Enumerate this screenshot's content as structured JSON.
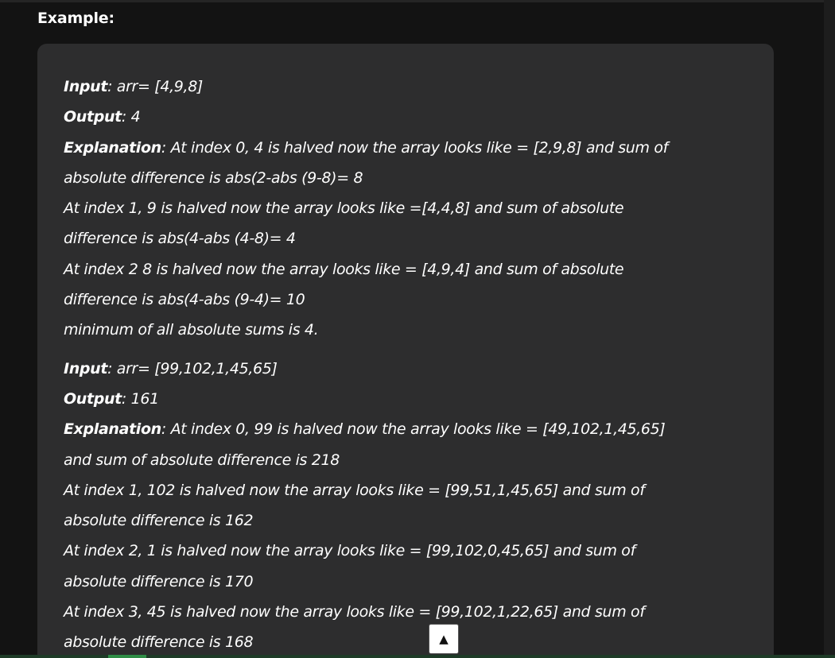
{
  "heading": "Example:",
  "labels": {
    "input": "Input",
    "output": "Output",
    "explanation": "Explanation"
  },
  "cases": [
    {
      "input": ": arr= [4,9,8]",
      "output": ": 4",
      "explanation_first": ": At index 0, 4 is halved now the array looks like = [2,9,8] and sum of",
      "lines": [
        "absolute difference is abs(2-abs (9-8)= 8",
        "At index 1, 9 is halved now the array looks like =[4,4,8] and sum of absolute",
        "difference is abs(4-abs (4-8)= 4",
        "At index 2 8 is halved now the array looks like = [4,9,4] and sum of absolute",
        "difference is abs(4-abs (9-4)= 10",
        "minimum of all absolute sums is 4."
      ]
    },
    {
      "input": ": arr= [99,102,1,45,65]",
      "output": ": 161",
      "explanation_first": ": At index 0, 99 is halved now the array looks like = [49,102,1,45,65]",
      "lines": [
        "and sum of absolute difference is 218",
        "At index 1, 102 is halved now the array looks like = [99,51,1,45,65] and sum of",
        "absolute difference is 162",
        "At index 2, 1 is halved now the array looks like = [99,102,0,45,65] and sum of",
        "absolute difference is 170",
        "At index 3, 45 is halved now the array looks like = [99,102,1,22,65] and sum of",
        "absolute difference is 168"
      ]
    }
  ],
  "scroll_top_icon": "arrow-up-icon",
  "scroll_top_glyph": "▲",
  "colors": {
    "page_background": "#131313",
    "box_background": "#2d2d2e",
    "text": "#ffffff",
    "accent_green": "#2f8d46"
  }
}
